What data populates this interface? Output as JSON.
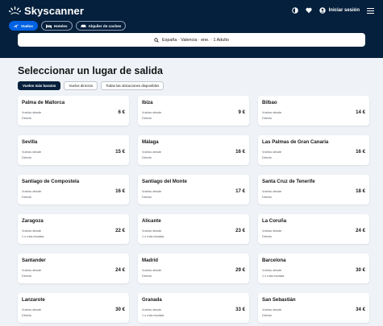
{
  "brand": {
    "name": "Skyscanner"
  },
  "header": {
    "login_label": "Iniciar sesión"
  },
  "nav": {
    "flights_label": "Vuelos",
    "hotels_label": "Hoteles",
    "cars_label": "Alquiler de coches"
  },
  "search": {
    "summary": "España · Valencia · ene. · 1 Adulto"
  },
  "page": {
    "title": "Seleccionar un lugar de salida"
  },
  "tabs": [
    {
      "label": "Vuelos más baratos"
    },
    {
      "label": "Vuelos directos"
    },
    {
      "label": "Todas las ubicaciones disponibles"
    }
  ],
  "results": [
    {
      "city": "Palma de Mallorca",
      "subtitle": "Vuelos desde",
      "price": "6 €",
      "stops": "Directo"
    },
    {
      "city": "Ibiza",
      "subtitle": "Vuelos desde",
      "price": "9 €",
      "stops": "Directo"
    },
    {
      "city": "Bilbao",
      "subtitle": "Vuelos desde",
      "price": "14 €",
      "stops": "Directo"
    },
    {
      "city": "Sevilla",
      "subtitle": "Vuelos desde",
      "price": "15 €",
      "stops": "Directo"
    },
    {
      "city": "Málaga",
      "subtitle": "Vuelos desde",
      "price": "16 €",
      "stops": "Directo"
    },
    {
      "city": "Las Palmas de Gran Canaria",
      "subtitle": "Vuelos desde",
      "price": "16 €",
      "stops": "Directo"
    },
    {
      "city": "Santiago de Compostela",
      "subtitle": "Vuelos desde",
      "price": "16 €",
      "stops": "Directo"
    },
    {
      "city": "Santiago del Monte",
      "subtitle": "Vuelos desde",
      "price": "17 €",
      "stops": "Directo"
    },
    {
      "city": "Santa Cruz de Tenerife",
      "subtitle": "Vuelos desde",
      "price": "18 €",
      "stops": "Directo"
    },
    {
      "city": "Zaragoza",
      "subtitle": "Vuelos desde",
      "price": "22 €",
      "stops": "1 o más escalas"
    },
    {
      "city": "Alicante",
      "subtitle": "Vuelos desde",
      "price": "23 €",
      "stops": "1 o más escalas"
    },
    {
      "city": "La Coruña",
      "subtitle": "Vuelos desde",
      "price": "24 €",
      "stops": "Directo"
    },
    {
      "city": "Santander",
      "subtitle": "Vuelos desde",
      "price": "24 €",
      "stops": "Directo"
    },
    {
      "city": "Madrid",
      "subtitle": "Vuelos desde",
      "price": "29 €",
      "stops": "Directo"
    },
    {
      "city": "Barcelona",
      "subtitle": "Vuelos desde",
      "price": "30 €",
      "stops": "1 o más escalas"
    },
    {
      "city": "Lanzarote",
      "subtitle": "Vuelos desde",
      "price": "30 €",
      "stops": "Directo"
    },
    {
      "city": "Granada",
      "subtitle": "Vuelos desde",
      "price": "33 €",
      "stops": "1 o más escalas"
    },
    {
      "city": "San Sebastián",
      "subtitle": "Vuelos desde",
      "price": "34 €",
      "stops": "Directo"
    }
  ],
  "icons": {
    "logo": "skyscanner-sunrise-icon",
    "theme": "contrast-icon",
    "favorites": "heart-icon",
    "user": "user-icon",
    "menu": "hamburger-menu-icon",
    "flights": "plane-icon",
    "hotels": "bed-icon",
    "cars": "car-icon",
    "search": "search-icon"
  },
  "colors": {
    "header_bg": "#05203c",
    "accent": "#0062e3",
    "page_bg": "#eff3f8",
    "card_bg": "#ffffff",
    "text": "#161616",
    "muted": "#545860"
  }
}
